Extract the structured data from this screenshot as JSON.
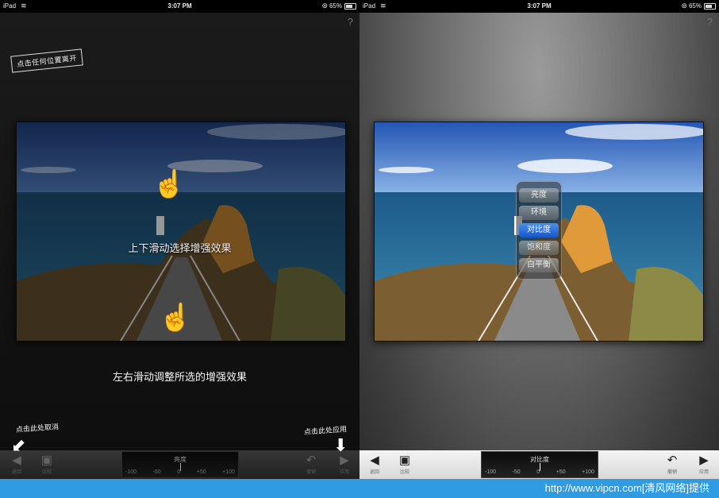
{
  "status_bar": {
    "device": "iPad",
    "time": "3:07 PM",
    "battery": "65%"
  },
  "help_label": "?",
  "left_screen": {
    "exit_hint": "点击任何位置离开",
    "vertical_hint": "上下滑动选择增强效果",
    "horizontal_hint": "左右滑动调整所选的增强效果",
    "cancel_hint": "点击此处取消",
    "apply_hint": "点击此处应用",
    "toolbar": {
      "back_label": "返回",
      "compare_label": "比较",
      "slider_name": "亮度",
      "slider_ticks": [
        "-100",
        "-50",
        "0",
        "+50",
        "+100"
      ],
      "undo_label": "撤销",
      "apply_label": "应用"
    }
  },
  "right_screen": {
    "enhance_menu": [
      {
        "label": "亮度",
        "selected": false
      },
      {
        "label": "环境",
        "selected": false
      },
      {
        "label": "对比度",
        "selected": true
      },
      {
        "label": "饱和度",
        "selected": false
      },
      {
        "label": "白平衡",
        "selected": false
      }
    ],
    "toolbar": {
      "back_label": "返回",
      "compare_label": "比较",
      "slider_name": "对比度",
      "slider_ticks": [
        "-100",
        "-50",
        "0",
        "+50",
        "+100"
      ],
      "undo_label": "撤销",
      "apply_label": "应用"
    }
  },
  "footer": {
    "text": "http://www.vipcn.com[清风网络]提供"
  },
  "colors": {
    "accent_selected": "#1f6fe0",
    "footer_bar": "#2f9be3"
  },
  "icons": [
    "wifi-icon",
    "lock-rotation-icon",
    "battery-icon",
    "back-arrow-icon",
    "compare-image-icon",
    "undo-icon",
    "apply-arrow-icon",
    "swipe-hand-icon"
  ]
}
